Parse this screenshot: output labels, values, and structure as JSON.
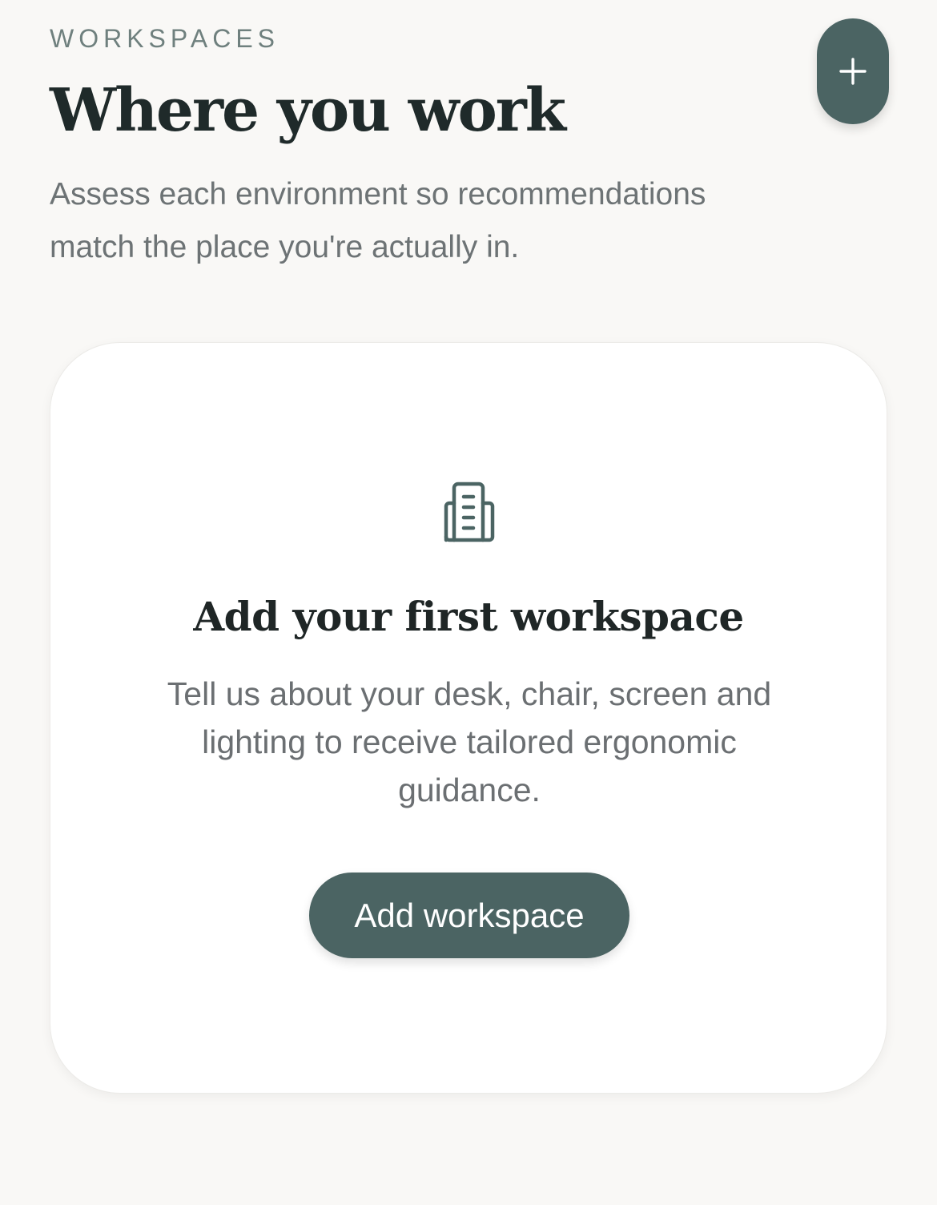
{
  "header": {
    "eyebrow": "WORKSPACES",
    "title": "Where you work",
    "subtitle": "Assess each environment so recommendations match the place you're actually in."
  },
  "fab": {
    "icon": "plus-icon",
    "color": "#4b6463"
  },
  "empty_state": {
    "icon": "building-icon",
    "title": "Add your first workspace",
    "description": "Tell us about your desk, chair, screen and lighting to receive tailored ergonomic guidance.",
    "button_label": "Add workspace"
  },
  "colors": {
    "background": "#f9f8f6",
    "accent": "#4b6463",
    "title_text": "#1f2a2a",
    "muted_text": "#6d7375"
  }
}
